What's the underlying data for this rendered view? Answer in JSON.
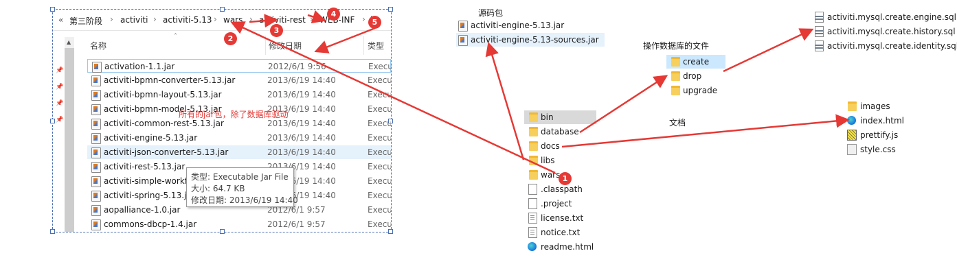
{
  "explorer": {
    "nav_back": "«",
    "breadcrumbs": [
      "第三阶段",
      "activiti",
      "activiti-5.13",
      "wars",
      "activiti-rest",
      "WEB-INF",
      "li"
    ],
    "columns": {
      "name": "名称",
      "date": "修改日期",
      "type": "类型"
    },
    "files": [
      {
        "name": "activation-1.1.jar",
        "date": "2012/6/1 9:56",
        "type": "Execu"
      },
      {
        "name": "activiti-bpmn-converter-5.13.jar",
        "date": "2013/6/19 14:40",
        "type": "Execu"
      },
      {
        "name": "activiti-bpmn-layout-5.13.jar",
        "date": "2013/6/19 14:40",
        "type": "Execu"
      },
      {
        "name": "activiti-bpmn-model-5.13.jar",
        "date": "2013/6/19 14:40",
        "type": "Execu"
      },
      {
        "name": "activiti-common-rest-5.13.jar",
        "date": "2013/6/19 14:40",
        "type": "Execu"
      },
      {
        "name": "activiti-engine-5.13.jar",
        "date": "2013/6/19 14:40",
        "type": "Execu"
      },
      {
        "name": "activiti-json-converter-5.13.jar",
        "date": "2013/6/19 14:40",
        "type": "Execu"
      },
      {
        "name": "activiti-rest-5.13.jar",
        "date": "2013/6/19 14:40",
        "type": "Execu"
      },
      {
        "name": "activiti-simple-workf",
        "date": "2013/6/19 14:40",
        "type": "Execu"
      },
      {
        "name": "activiti-spring-5.13.ja",
        "date": "2013/6/19 14:40",
        "type": "Execu"
      },
      {
        "name": "aopalliance-1.0.jar",
        "date": "2012/6/1 9:57",
        "type": "Execu"
      },
      {
        "name": "commons-dbcp-1.4.jar",
        "date": "2012/6/1 9:57",
        "type": "Execu"
      }
    ],
    "tooltip": {
      "type_line": "类型: Executable Jar File",
      "size_line": "大小: 64.7 KB",
      "date_line": "修改日期: 2013/6/19 14:40"
    }
  },
  "annotations": {
    "jar_note": "所有的jar包，除了数据库驱动",
    "source_title": "源码包",
    "db_ops_title": "操作数据库的文件",
    "docs_title": "文档",
    "badges": [
      "1",
      "2",
      "3",
      "4",
      "5"
    ]
  },
  "source_jars": [
    "activiti-engine-5.13.jar",
    "activiti-engine-5.13-sources.jar"
  ],
  "root_items": [
    "bin",
    "database",
    "docs",
    "libs",
    "wars",
    ".classpath",
    ".project",
    "license.txt",
    "notice.txt",
    "readme.html"
  ],
  "database_items": [
    "create",
    "drop",
    "upgrade"
  ],
  "sql_files": [
    "activiti.mysql.create.engine.sql",
    "activiti.mysql.create.history.sql",
    "activiti.mysql.create.identity.sql"
  ],
  "docs_items": [
    "images",
    "index.html",
    "prettify.js",
    "style.css"
  ],
  "colors": {
    "arrow": "#e53935",
    "selection": "#cce8ff",
    "hover": "#e5f1fb"
  }
}
